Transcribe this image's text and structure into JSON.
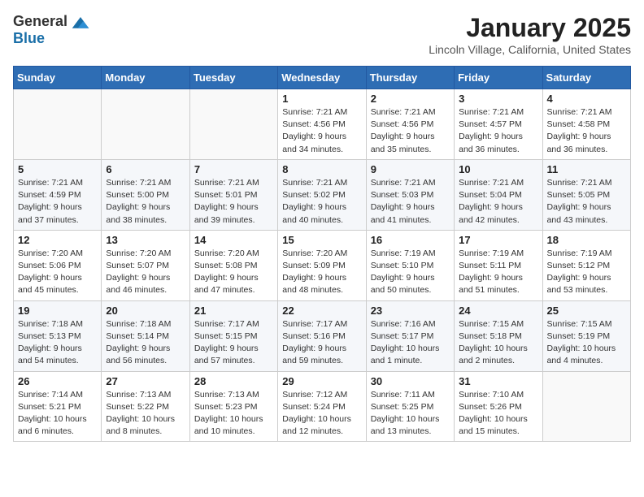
{
  "header": {
    "logo_general": "General",
    "logo_blue": "Blue",
    "month_title": "January 2025",
    "location": "Lincoln Village, California, United States"
  },
  "weekdays": [
    "Sunday",
    "Monday",
    "Tuesday",
    "Wednesday",
    "Thursday",
    "Friday",
    "Saturday"
  ],
  "weeks": [
    [
      {
        "day": "",
        "info": ""
      },
      {
        "day": "",
        "info": ""
      },
      {
        "day": "",
        "info": ""
      },
      {
        "day": "1",
        "info": "Sunrise: 7:21 AM\nSunset: 4:56 PM\nDaylight: 9 hours\nand 34 minutes."
      },
      {
        "day": "2",
        "info": "Sunrise: 7:21 AM\nSunset: 4:56 PM\nDaylight: 9 hours\nand 35 minutes."
      },
      {
        "day": "3",
        "info": "Sunrise: 7:21 AM\nSunset: 4:57 PM\nDaylight: 9 hours\nand 36 minutes."
      },
      {
        "day": "4",
        "info": "Sunrise: 7:21 AM\nSunset: 4:58 PM\nDaylight: 9 hours\nand 36 minutes."
      }
    ],
    [
      {
        "day": "5",
        "info": "Sunrise: 7:21 AM\nSunset: 4:59 PM\nDaylight: 9 hours\nand 37 minutes."
      },
      {
        "day": "6",
        "info": "Sunrise: 7:21 AM\nSunset: 5:00 PM\nDaylight: 9 hours\nand 38 minutes."
      },
      {
        "day": "7",
        "info": "Sunrise: 7:21 AM\nSunset: 5:01 PM\nDaylight: 9 hours\nand 39 minutes."
      },
      {
        "day": "8",
        "info": "Sunrise: 7:21 AM\nSunset: 5:02 PM\nDaylight: 9 hours\nand 40 minutes."
      },
      {
        "day": "9",
        "info": "Sunrise: 7:21 AM\nSunset: 5:03 PM\nDaylight: 9 hours\nand 41 minutes."
      },
      {
        "day": "10",
        "info": "Sunrise: 7:21 AM\nSunset: 5:04 PM\nDaylight: 9 hours\nand 42 minutes."
      },
      {
        "day": "11",
        "info": "Sunrise: 7:21 AM\nSunset: 5:05 PM\nDaylight: 9 hours\nand 43 minutes."
      }
    ],
    [
      {
        "day": "12",
        "info": "Sunrise: 7:20 AM\nSunset: 5:06 PM\nDaylight: 9 hours\nand 45 minutes."
      },
      {
        "day": "13",
        "info": "Sunrise: 7:20 AM\nSunset: 5:07 PM\nDaylight: 9 hours\nand 46 minutes."
      },
      {
        "day": "14",
        "info": "Sunrise: 7:20 AM\nSunset: 5:08 PM\nDaylight: 9 hours\nand 47 minutes."
      },
      {
        "day": "15",
        "info": "Sunrise: 7:20 AM\nSunset: 5:09 PM\nDaylight: 9 hours\nand 48 minutes."
      },
      {
        "day": "16",
        "info": "Sunrise: 7:19 AM\nSunset: 5:10 PM\nDaylight: 9 hours\nand 50 minutes."
      },
      {
        "day": "17",
        "info": "Sunrise: 7:19 AM\nSunset: 5:11 PM\nDaylight: 9 hours\nand 51 minutes."
      },
      {
        "day": "18",
        "info": "Sunrise: 7:19 AM\nSunset: 5:12 PM\nDaylight: 9 hours\nand 53 minutes."
      }
    ],
    [
      {
        "day": "19",
        "info": "Sunrise: 7:18 AM\nSunset: 5:13 PM\nDaylight: 9 hours\nand 54 minutes."
      },
      {
        "day": "20",
        "info": "Sunrise: 7:18 AM\nSunset: 5:14 PM\nDaylight: 9 hours\nand 56 minutes."
      },
      {
        "day": "21",
        "info": "Sunrise: 7:17 AM\nSunset: 5:15 PM\nDaylight: 9 hours\nand 57 minutes."
      },
      {
        "day": "22",
        "info": "Sunrise: 7:17 AM\nSunset: 5:16 PM\nDaylight: 9 hours\nand 59 minutes."
      },
      {
        "day": "23",
        "info": "Sunrise: 7:16 AM\nSunset: 5:17 PM\nDaylight: 10 hours\nand 1 minute."
      },
      {
        "day": "24",
        "info": "Sunrise: 7:15 AM\nSunset: 5:18 PM\nDaylight: 10 hours\nand 2 minutes."
      },
      {
        "day": "25",
        "info": "Sunrise: 7:15 AM\nSunset: 5:19 PM\nDaylight: 10 hours\nand 4 minutes."
      }
    ],
    [
      {
        "day": "26",
        "info": "Sunrise: 7:14 AM\nSunset: 5:21 PM\nDaylight: 10 hours\nand 6 minutes."
      },
      {
        "day": "27",
        "info": "Sunrise: 7:13 AM\nSunset: 5:22 PM\nDaylight: 10 hours\nand 8 minutes."
      },
      {
        "day": "28",
        "info": "Sunrise: 7:13 AM\nSunset: 5:23 PM\nDaylight: 10 hours\nand 10 minutes."
      },
      {
        "day": "29",
        "info": "Sunrise: 7:12 AM\nSunset: 5:24 PM\nDaylight: 10 hours\nand 12 minutes."
      },
      {
        "day": "30",
        "info": "Sunrise: 7:11 AM\nSunset: 5:25 PM\nDaylight: 10 hours\nand 13 minutes."
      },
      {
        "day": "31",
        "info": "Sunrise: 7:10 AM\nSunset: 5:26 PM\nDaylight: 10 hours\nand 15 minutes."
      },
      {
        "day": "",
        "info": ""
      }
    ]
  ]
}
